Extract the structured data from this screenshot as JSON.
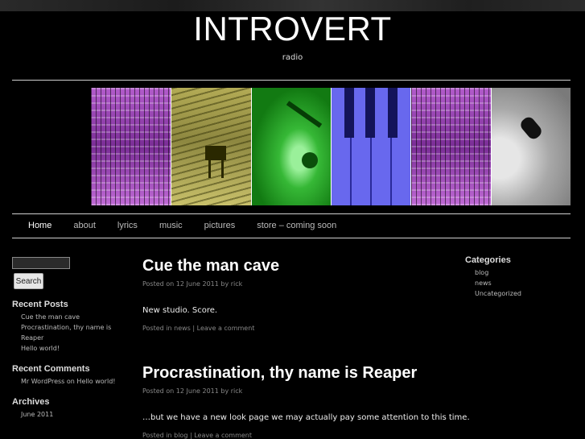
{
  "site": {
    "title": "INTROVERT",
    "description": "radio"
  },
  "colors": {
    "background": "#000000",
    "accent_purple": "#9b3fb3",
    "accent_yellow": "#9a9440",
    "accent_green": "#33b533",
    "accent_blue": "#5d5de0"
  },
  "banner": {
    "panels": [
      "modular-synth-purple",
      "concert-hall-piano-yellow",
      "microphone-green",
      "piano-keys-blue",
      "modular-synth-purple-2",
      "vinyl-tonearm-gray"
    ]
  },
  "nav": {
    "items": [
      "Home",
      "about",
      "lyrics",
      "music",
      "pictures",
      "store – coming soon"
    ]
  },
  "search": {
    "button_label": "Search",
    "value": ""
  },
  "recent_posts": {
    "title": "Recent Posts",
    "items": [
      "Cue the man cave",
      "Procrastination, thy name is",
      "Reaper",
      "Hello world!"
    ]
  },
  "recent_comments": {
    "title": "Recent Comments",
    "author": "Mr WordPress",
    "on": "on",
    "post": "Hello world!"
  },
  "archives": {
    "title": "Archives",
    "items": [
      "June 2011"
    ]
  },
  "categories": {
    "title": "Categories",
    "items": [
      "blog",
      "news",
      "Uncategorized"
    ]
  },
  "posts": [
    {
      "title": "Cue the man cave",
      "meta_prefix": "Posted on",
      "date": "12 June 2011",
      "meta_by": "by",
      "author": "rick",
      "body": "New studio.  Score.",
      "footer_prefix": "Posted in",
      "category": "news",
      "separator": "|",
      "comment_link": "Leave a comment"
    },
    {
      "title": "Procrastination, thy name is Reaper",
      "meta_prefix": "Posted on",
      "date": "12 June 2011",
      "meta_by": "by",
      "author": "rick",
      "body": "…but we have a new look page we may actually pay some attention to this time.",
      "footer_prefix": "Posted in",
      "category": "blog",
      "separator": "|",
      "comment_link": "Leave a comment"
    }
  ]
}
